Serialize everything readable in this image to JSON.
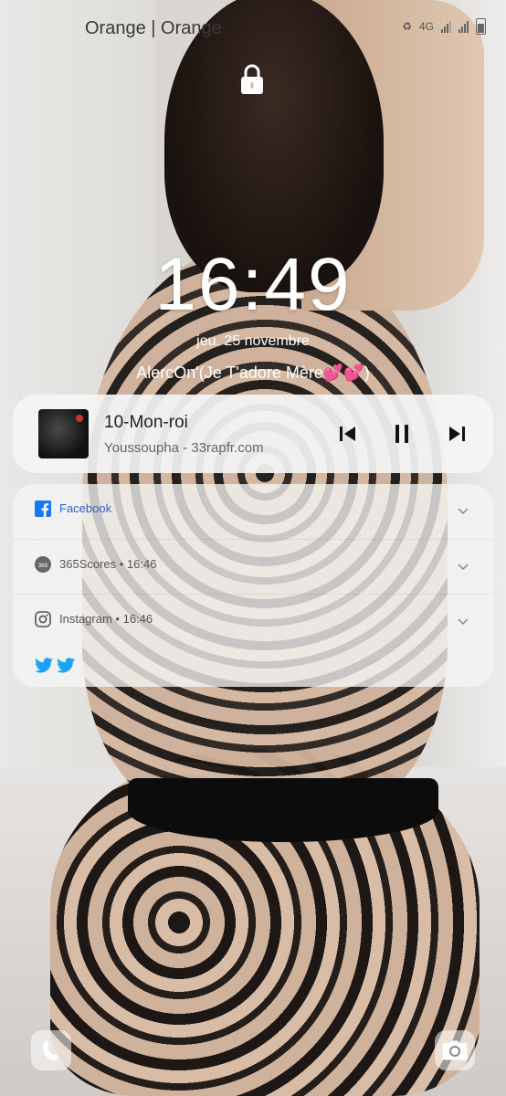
{
  "status_bar": {
    "carrier": "Orange | Orange",
    "network": "4G",
    "icons": [
      "recycle-icon",
      "network-4g-icon",
      "signal-icon",
      "signal-icon",
      "battery-icon"
    ]
  },
  "lockscreen": {
    "time": "16:49",
    "date": "jeu. 25 novembre",
    "owner_info": "AlercOn'(Je T'adore Mère💕💕)"
  },
  "media": {
    "title": "10-Mon-roi",
    "artist": "Youssoupha - 33rapfr.com",
    "controls": [
      "previous-icon",
      "pause-icon",
      "next-icon"
    ]
  },
  "notifications": [
    {
      "app": "Facebook",
      "time": "",
      "icon": "facebook-icon"
    },
    {
      "app": "365Scores",
      "time": "16:46",
      "icon": "365scores-icon"
    },
    {
      "app": "Instagram",
      "time": "16:46",
      "icon": "instagram-icon"
    }
  ],
  "notification_icons_extra": [
    "twitter-icon",
    "twitter-icon"
  ],
  "shortcuts": [
    "phone-icon",
    "camera-icon"
  ],
  "colors": {
    "facebook": "#1877f2",
    "twitter": "#1da1f2",
    "clock": "#ffffff"
  }
}
